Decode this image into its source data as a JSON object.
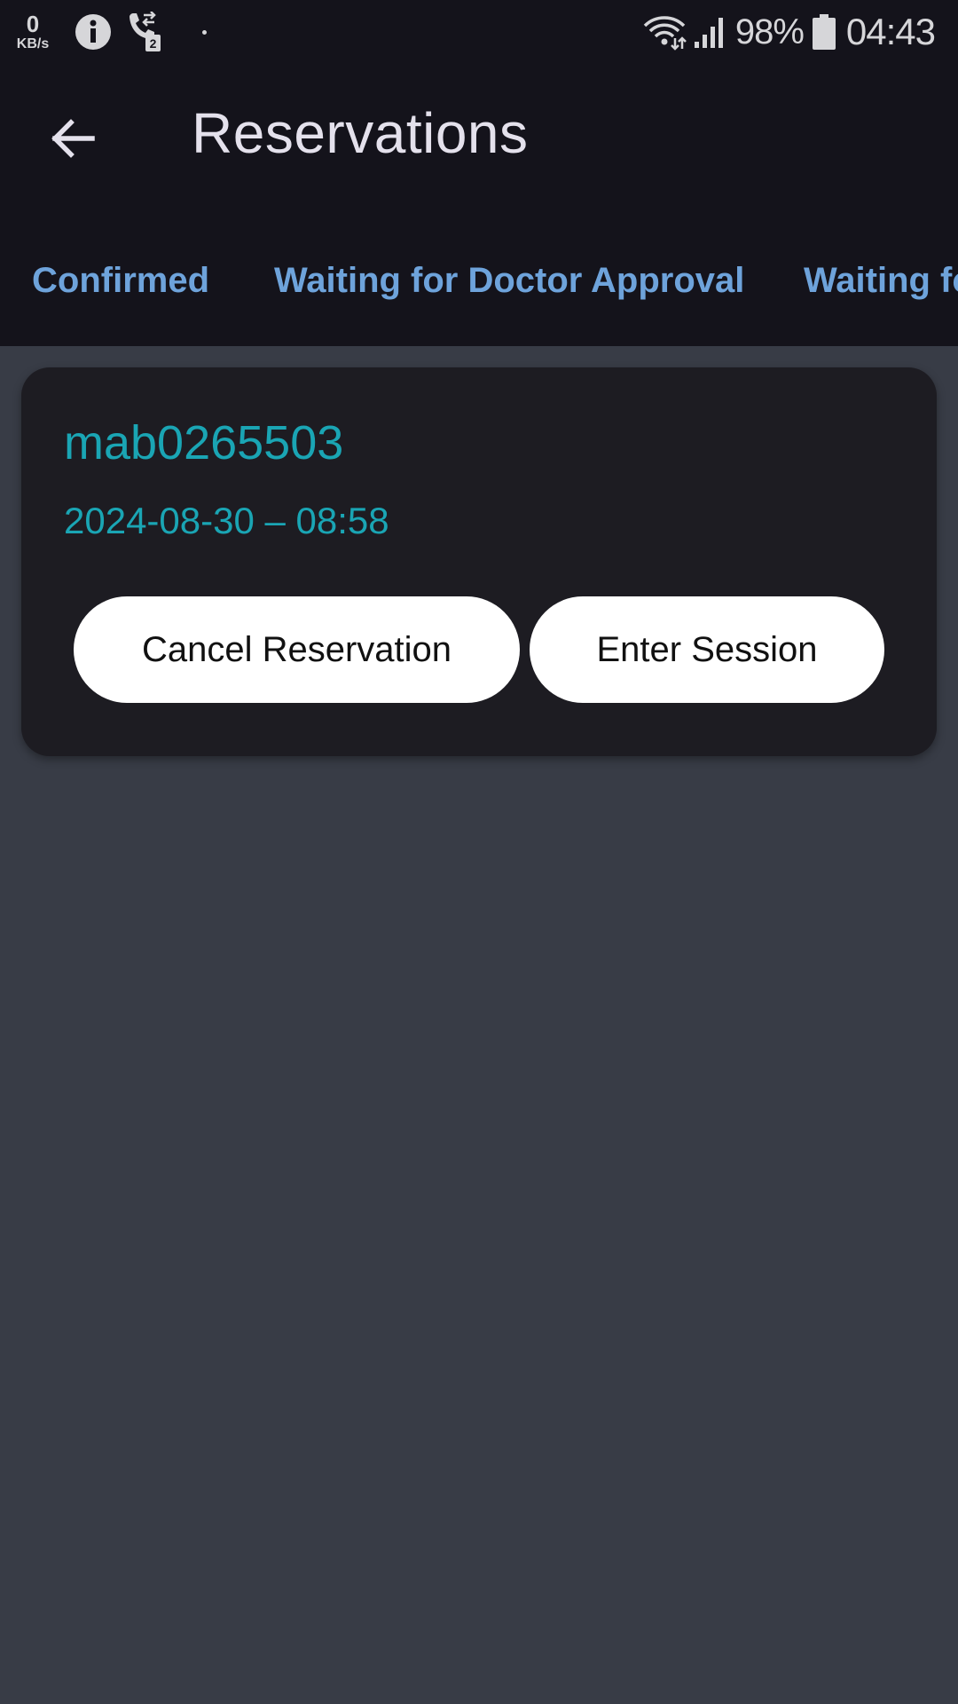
{
  "status_bar": {
    "net_speed_value": "0",
    "net_speed_unit": "KB/s",
    "sim_slot": "2",
    "battery_percent": "98%",
    "time": "04:43",
    "icons": [
      "info-icon",
      "call-forwarding-icon",
      "notification-dot-icon",
      "wifi-icon",
      "signal-icon",
      "battery-icon"
    ]
  },
  "app_bar": {
    "back_icon": "arrow-back-icon",
    "title": "Reservations"
  },
  "tabs": [
    {
      "label": "Confirmed"
    },
    {
      "label": "Waiting for Doctor Approval"
    },
    {
      "label": "Waiting fo"
    }
  ],
  "reservation": {
    "code": "mab0265503",
    "datetime": "2024-08-30 – 08:58",
    "cancel_label": "Cancel Reservation",
    "enter_label": "Enter Session"
  },
  "colors": {
    "bar_background": "#14131b",
    "page_background": "#383c46",
    "card_background": "#1d1c22",
    "tab_text": "#6ea3db",
    "accent_teal": "#1aa5b4",
    "button_background": "#ffffff"
  }
}
